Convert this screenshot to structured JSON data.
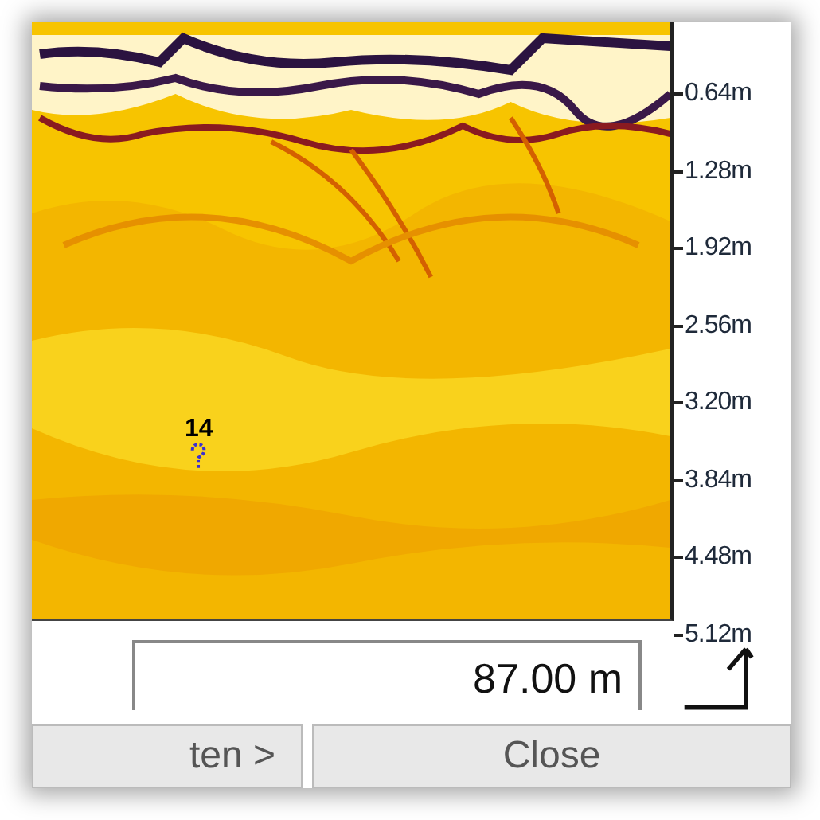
{
  "radargram": {
    "kind": "picture",
    "markers": [
      {
        "label": "14"
      }
    ]
  },
  "depth_axis": {
    "ticks": [
      "0.64m",
      "1.28m",
      "1.92m",
      "2.56m",
      "3.20m",
      "3.84m",
      "4.48m",
      "5.12m"
    ]
  },
  "distance_field": {
    "value": "87.00 m"
  },
  "buttons": [
    "ten >",
    "Close"
  ]
}
